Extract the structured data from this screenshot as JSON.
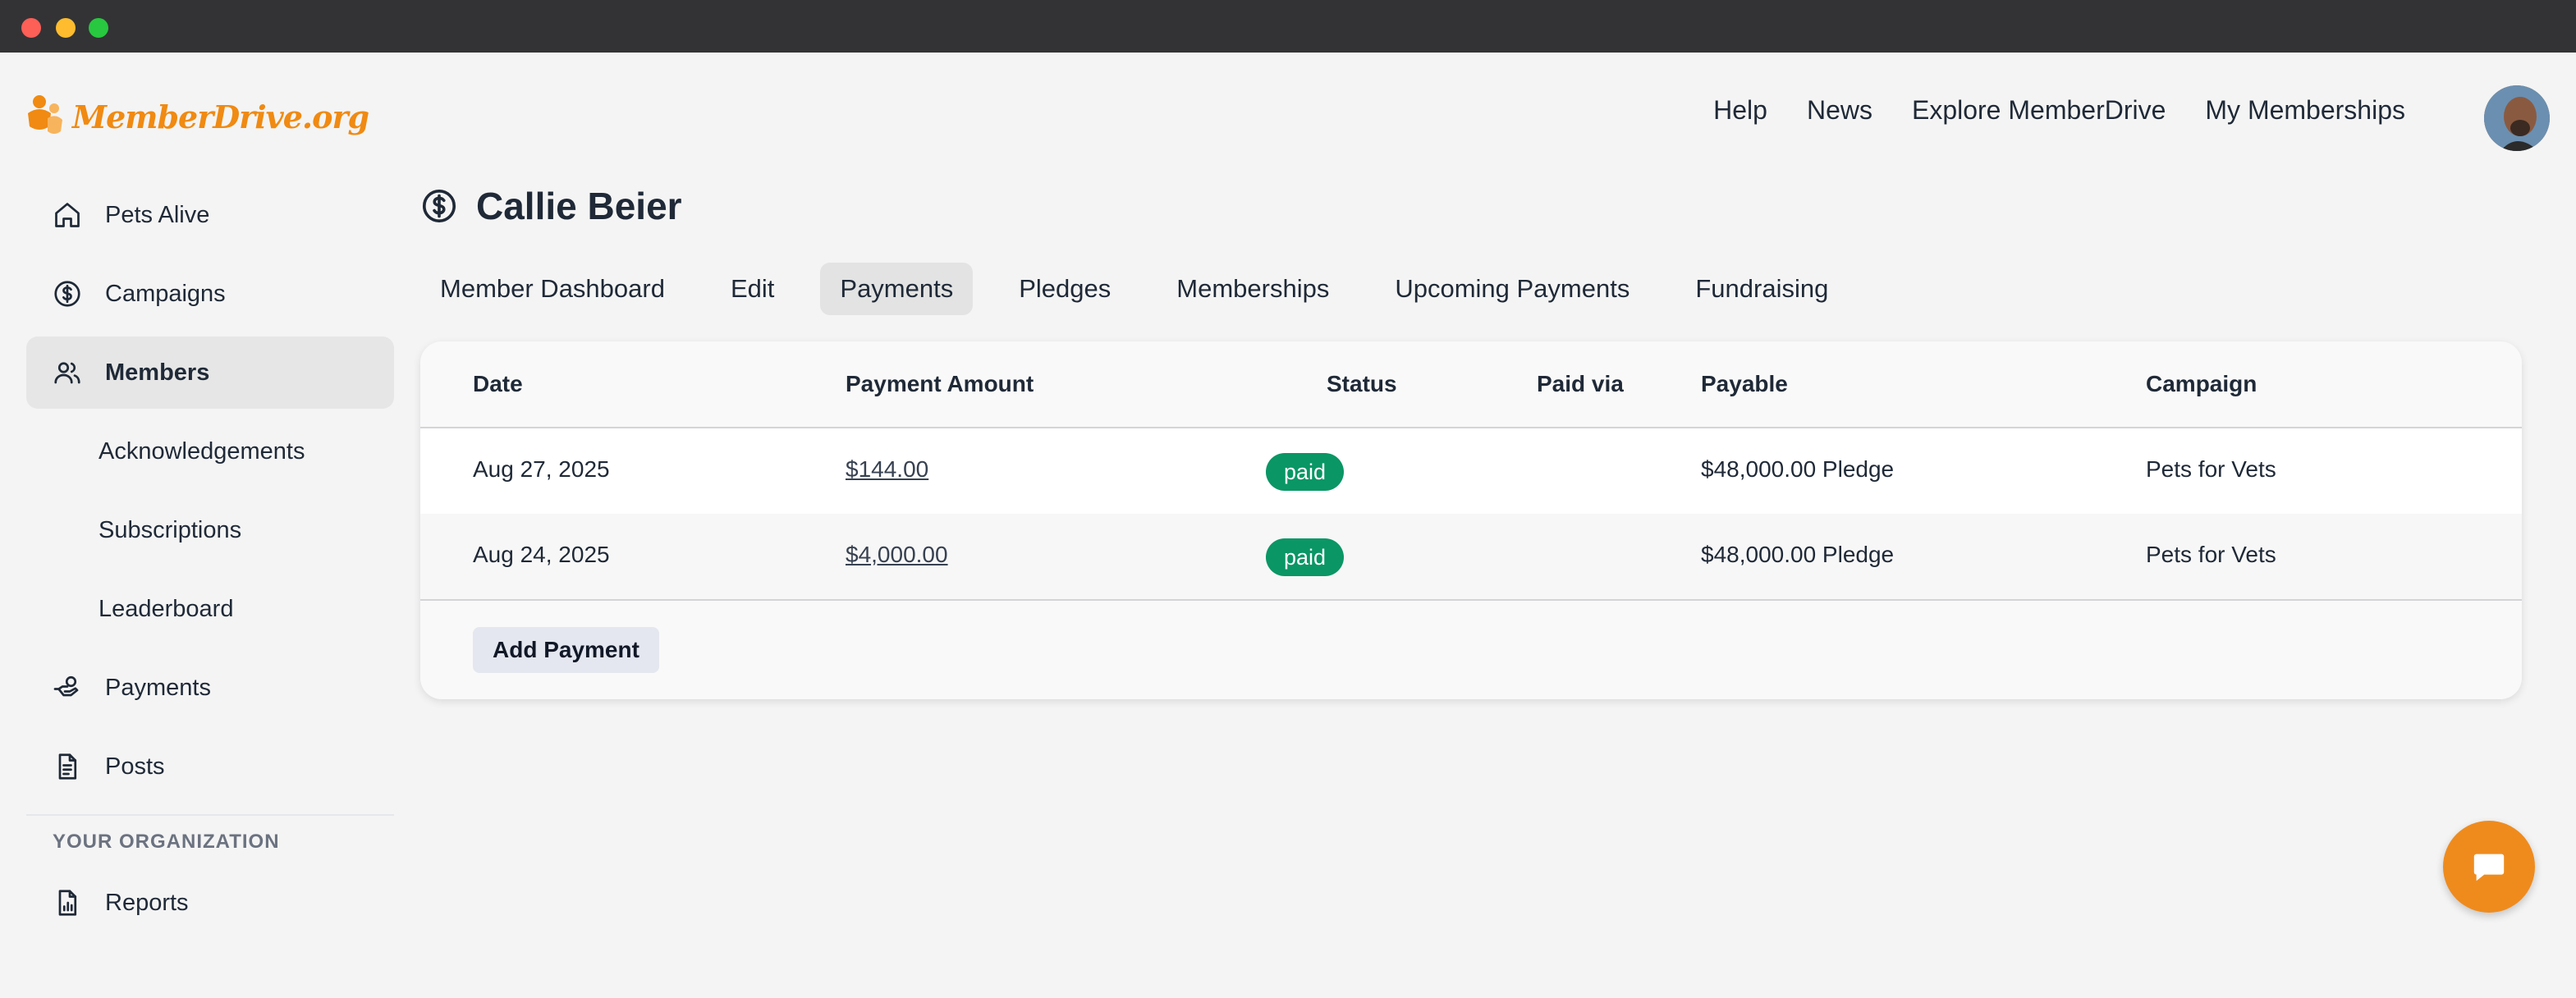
{
  "logo": {
    "text": "MemberDrive.org"
  },
  "topnav": {
    "items": [
      {
        "label": "Help"
      },
      {
        "label": "News"
      },
      {
        "label": "Explore MemberDrive"
      },
      {
        "label": "My Memberships"
      }
    ]
  },
  "sidebar": {
    "items": [
      {
        "label": "Pets Alive",
        "icon": "home-icon"
      },
      {
        "label": "Campaigns",
        "icon": "dollar-circle-icon"
      },
      {
        "label": "Members",
        "icon": "users-icon",
        "active": true
      },
      {
        "label": "Acknowledgements"
      },
      {
        "label": "Subscriptions"
      },
      {
        "label": "Leaderboard"
      },
      {
        "label": "Payments",
        "icon": "hand-coin-icon"
      },
      {
        "label": "Posts",
        "icon": "document-icon"
      }
    ],
    "section_label": "YOUR ORGANIZATION",
    "org_items": [
      {
        "label": "Reports",
        "icon": "report-icon"
      }
    ]
  },
  "page": {
    "title": "Callie Beier",
    "title_icon": "dollar-circle-icon"
  },
  "tabs": [
    {
      "label": "Member Dashboard"
    },
    {
      "label": "Edit"
    },
    {
      "label": "Payments",
      "active": true
    },
    {
      "label": "Pledges"
    },
    {
      "label": "Memberships"
    },
    {
      "label": "Upcoming Payments"
    },
    {
      "label": "Fundraising"
    }
  ],
  "table": {
    "headers": [
      "Date",
      "Payment Amount",
      "Status",
      "Paid via",
      "Payable",
      "Campaign"
    ],
    "rows": [
      {
        "date": "Aug 27, 2025",
        "amount": "$144.00",
        "status": "paid",
        "paid_via": "",
        "payable": "$48,000.00 Pledge",
        "campaign": "Pets for Vets"
      },
      {
        "date": "Aug 24, 2025",
        "amount": "$4,000.00",
        "status": "paid",
        "paid_via": "",
        "payable": "$48,000.00 Pledge",
        "campaign": "Pets for Vets"
      }
    ],
    "add_button": "Add Payment"
  },
  "colors": {
    "brand": "#f08a12",
    "paid_badge": "#0a9665",
    "chat_button": "#ef8b1d"
  },
  "chat": {
    "icon": "chat-bubble-icon"
  }
}
